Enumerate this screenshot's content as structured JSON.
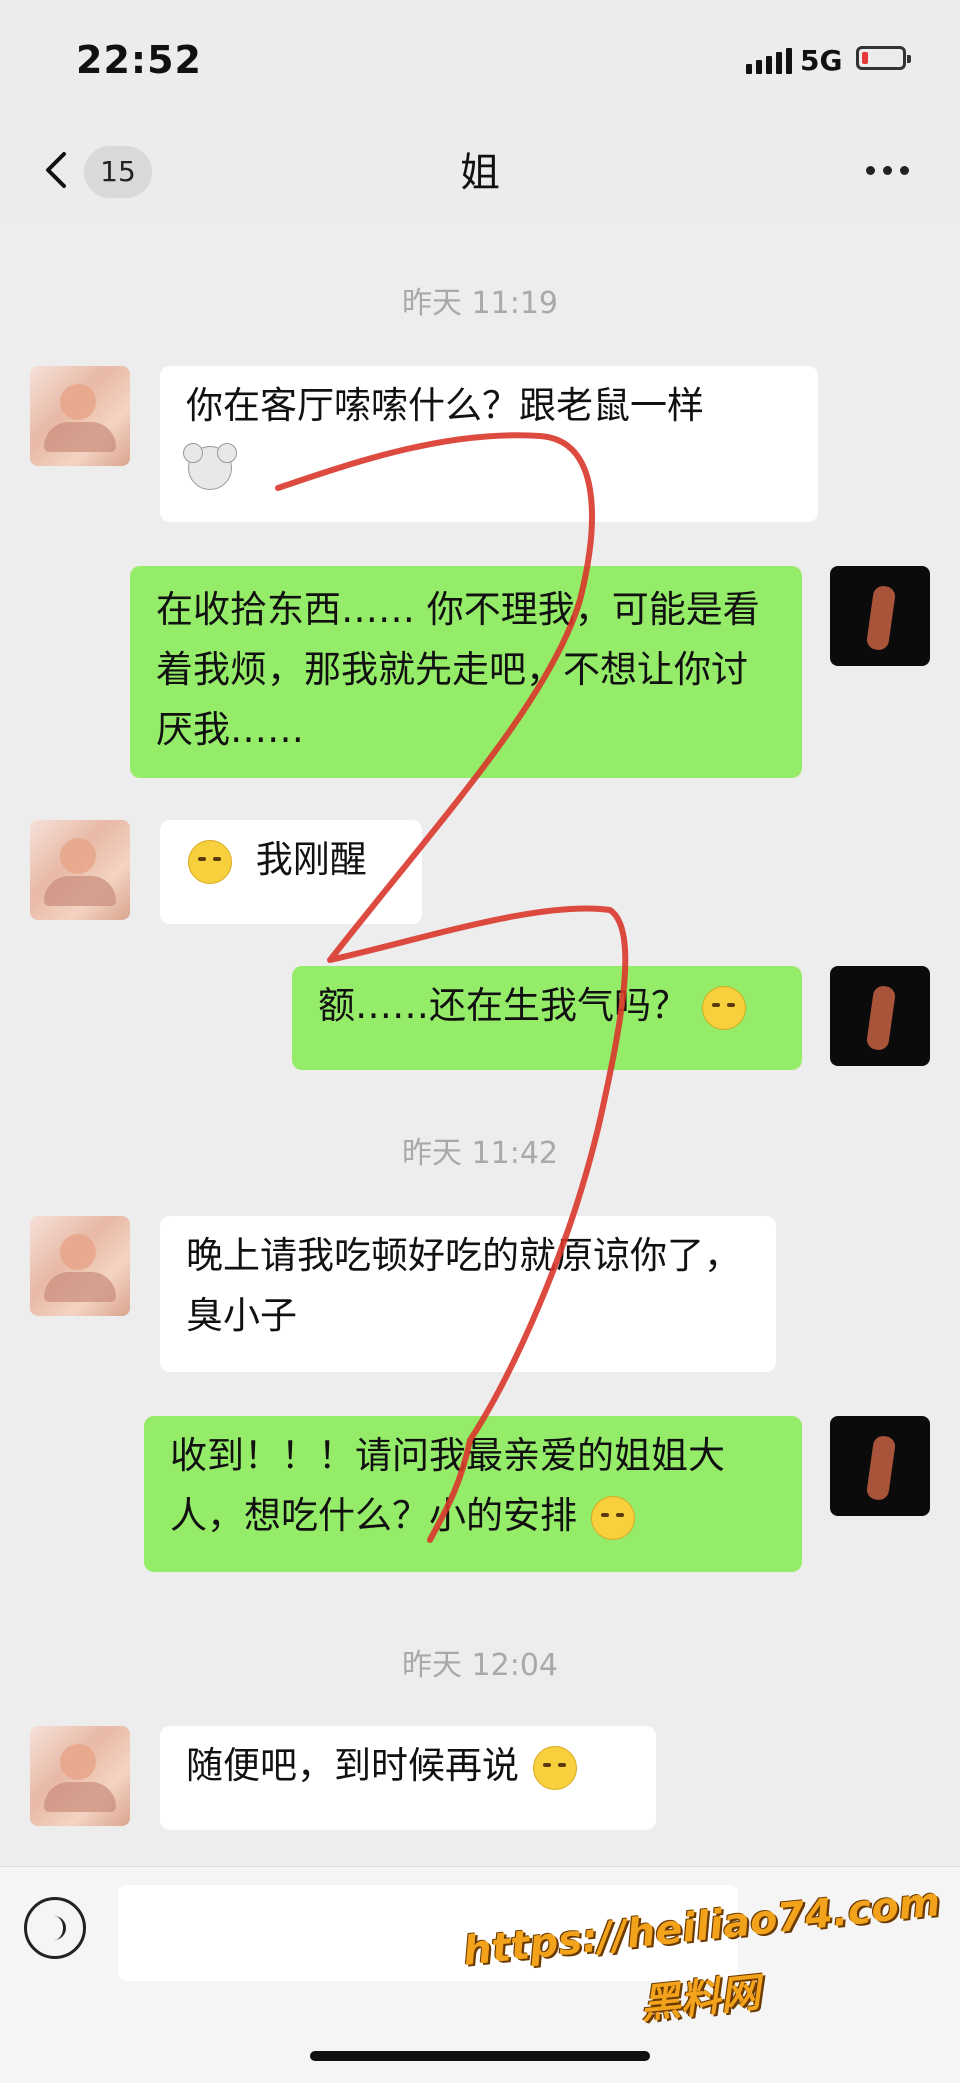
{
  "status_bar": {
    "time": "22:52",
    "network": "5G",
    "battery": "low"
  },
  "nav": {
    "back_count": "15",
    "title": "姐",
    "more": "more-icon"
  },
  "messages": {
    "ts1": "昨天 11:19",
    "m1": "你在客厅嗦嗦什么？跟老鼠一样",
    "m2": "在收拾东西…… 你不理我，可能是看着我烦，那我就先走吧，不想让你讨厌我……",
    "m3": "我刚醒",
    "m4": "额……还在生我气吗？",
    "ts2": "昨天 11:42",
    "m5": "晚上请我吃顿好吃的就原谅你了，臭小子",
    "m6": "收到！！！请问我最亲爱的姐姐大人，想吃什么？小的安排",
    "ts3": "昨天 12:04",
    "m7": "随便吧，到时候再说"
  },
  "watermark": {
    "line1": "https://heiliao74.com",
    "line2": "黑料网"
  },
  "colors": {
    "sent_bubble": "#95ec69",
    "recv_bubble": "#ffffff",
    "background": "#ededed",
    "scribble": "#d9362a"
  }
}
